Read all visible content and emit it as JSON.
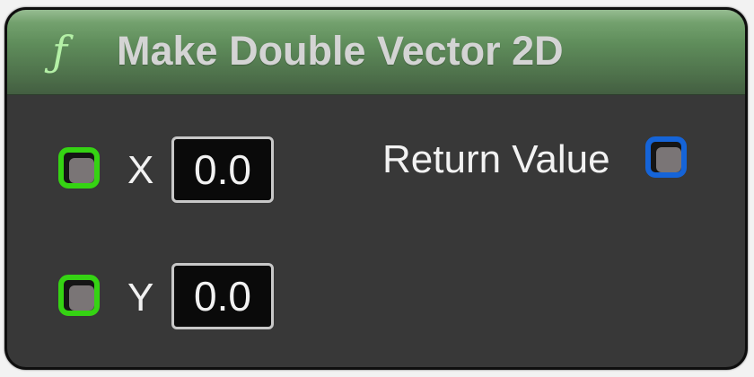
{
  "node": {
    "title": "Make Double Vector 2D",
    "icon": "function-icon",
    "icon_glyph": "ƒ",
    "header_color": "#5f8d5b",
    "body_color": "#383838"
  },
  "inputs": [
    {
      "label": "X",
      "value": "0.0",
      "pin_color": "#35d313"
    },
    {
      "label": "Y",
      "value": "0.0",
      "pin_color": "#35d313"
    }
  ],
  "outputs": [
    {
      "label": "Return Value",
      "pin_color": "#1564d8"
    }
  ]
}
